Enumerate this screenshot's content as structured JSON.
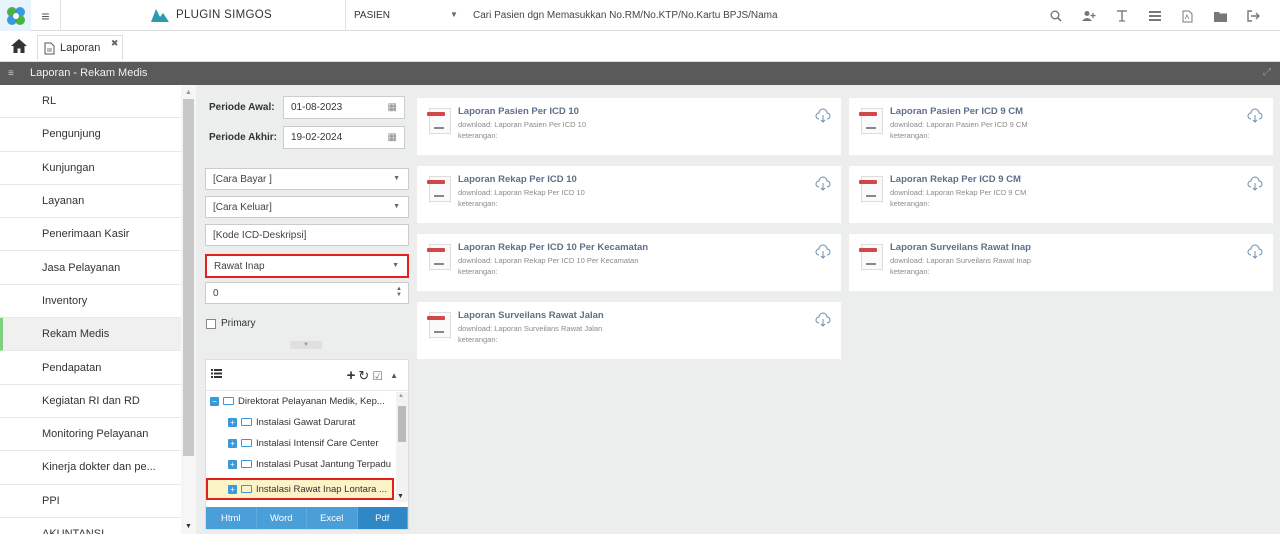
{
  "app": {
    "brand": "PLUGIN SIMGOS"
  },
  "topbar": {
    "pasien_label": "PASIEN",
    "search_text": "Cari Pasien dgn Memasukkan No.RM/No.KTP/No.Kartu BPJS/Nama",
    "icons": [
      "search-icon",
      "add-user-icon",
      "text-icon",
      "list-icon",
      "pdf-icon",
      "folder-icon",
      "logout-icon"
    ]
  },
  "tabs": [
    {
      "label": "Laporan"
    }
  ],
  "header": {
    "title": "Laporan - Rekam Medis"
  },
  "sidebar": {
    "items": [
      {
        "label": "RL"
      },
      {
        "label": "Pengunjung"
      },
      {
        "label": "Kunjungan"
      },
      {
        "label": "Layanan"
      },
      {
        "label": "Penerimaan Kasir"
      },
      {
        "label": "Jasa Pelayanan"
      },
      {
        "label": "Inventory"
      },
      {
        "label": "Rekam Medis",
        "active": true
      },
      {
        "label": "Pendapatan"
      },
      {
        "label": "Kegiatan RI dan RD"
      },
      {
        "label": "Monitoring Pelayanan"
      },
      {
        "label": "Kinerja dokter dan pe..."
      },
      {
        "label": "PPI"
      },
      {
        "label": "AKUNTANSI"
      }
    ]
  },
  "filter": {
    "periode_awal_label": "Periode Awal:",
    "periode_awal": "01-08-2023",
    "periode_akhir_label": "Periode Akhir:",
    "periode_akhir": "19-02-2024",
    "cara_bayar": "[Cara Bayar ]",
    "cara_keluar": "[Cara Keluar]",
    "kode_icd": "[Kode ICD-Deskripsi]",
    "jenis": "Rawat Inap",
    "jumlah": "0",
    "primary_label": "Primary"
  },
  "tree": {
    "nodes": [
      {
        "label": "Direktorat Pelayanan Medik, Kep...",
        "expanded": true
      },
      {
        "label": "Instalasi Gawat Darurat"
      },
      {
        "label": "Instalasi Intensif Care Center"
      },
      {
        "label": "Instalasi Pusat Jantung Terpadu"
      },
      {
        "label": "Instalasi Rawat Inap Lontara ...",
        "selected": true
      }
    ],
    "export_buttons": [
      "Html",
      "Word",
      "Excel",
      "Pdf"
    ]
  },
  "cards": [
    {
      "title": "Laporan Pasien Per ICD 10",
      "download": "download: Laporan Pasien Per ICD 10",
      "keterangan": "keterangan:"
    },
    {
      "title": "Laporan Pasien Per ICD 9 CM",
      "download": "download: Laporan Pasien Per ICD 9 CM",
      "keterangan": "keterangan:"
    },
    {
      "title": "Laporan Rekap Per ICD 10",
      "download": "download: Laporan Rekap Per ICD 10",
      "keterangan": "keterangan:"
    },
    {
      "title": "Laporan Rekap Per ICD 9 CM",
      "download": "download: Laporan Rekap Per ICD 9 CM",
      "keterangan": "keterangan:"
    },
    {
      "title": "Laporan Rekap Per ICD 10 Per Kecamatan",
      "download": "download: Laporan Rekap Per ICD 10 Per Kecamatan",
      "keterangan": "keterangan:"
    },
    {
      "title": "Laporan Surveilans Rawat Inap",
      "download": "download: Laporan Surveilans Rawat Inap",
      "keterangan": "keterangan:"
    },
    {
      "title": "Laporan Surveilans Rawat Jalan",
      "download": "download: Laporan Surveilans Rawat Jalan",
      "keterangan": "keterangan:"
    }
  ],
  "colors": {
    "accent": "#4a9fd9",
    "highlight": "#e41f1f",
    "header": "#5a5a5a",
    "active_marker": "#7fd07f"
  }
}
